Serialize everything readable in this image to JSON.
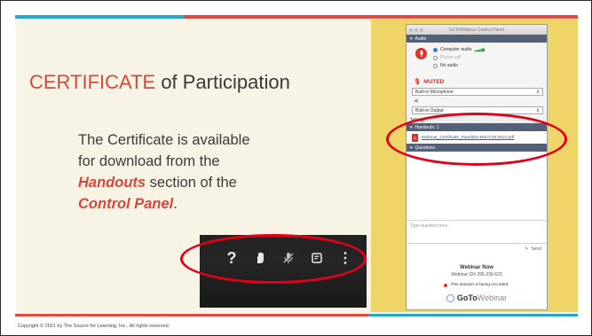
{
  "colors": {
    "accent_red": "#d4483d",
    "accent_teal": "#27a7c9",
    "slide_bg": "#f8f4e5",
    "side_yellow": "#efd567",
    "highlight_oval": "#e3001b"
  },
  "slide": {
    "title_accent": "CERTIFICATE",
    "title_rest": " of Participation",
    "body_line1": "The Certificate is available",
    "body_line2": "for download from the",
    "body_handouts": "Handouts",
    "body_line3_rest": " section of the",
    "body_control_panel": "Control Panel",
    "body_period": "."
  },
  "toolbar": {
    "icons": [
      "question-icon",
      "hand-raise-icon",
      "microphone-muted-icon",
      "notes-icon",
      "more-icon"
    ],
    "question_glyph": "?",
    "hand_glyph": "✋",
    "mic_glyph": "🎙",
    "notes_glyph": "▣",
    "more_glyph": "⋮"
  },
  "control_panel": {
    "window_title": "GoToWebinar Control Panel",
    "audio_header": "Audio",
    "option_computer_audio": "Computer audio",
    "option_phone_call": "Phone call",
    "option_no_audio": "No audio",
    "muted_label": "MUTED",
    "mic_select": "Built-in Microphone",
    "output_select": "Built-in Output",
    "talking_label": "Talking:",
    "handouts_header": "Handouts: 1",
    "handout_file": "Webinar_Certificate_PanelDis-March18-2021.pdf",
    "questions_header": "Questions",
    "question_placeholder": "Type question here.",
    "send_label": "Send",
    "webinar_name": "Webinar Now",
    "webinar_id": "Webinar ID# 295-239-523",
    "recording_notice": "This session is being recorded.",
    "brand_bold": "GoTo",
    "brand_light": "Webinar"
  },
  "footer": {
    "copyright": "Copyright © 2021 by The Source for Learning, Inc.. All rights reserved."
  }
}
